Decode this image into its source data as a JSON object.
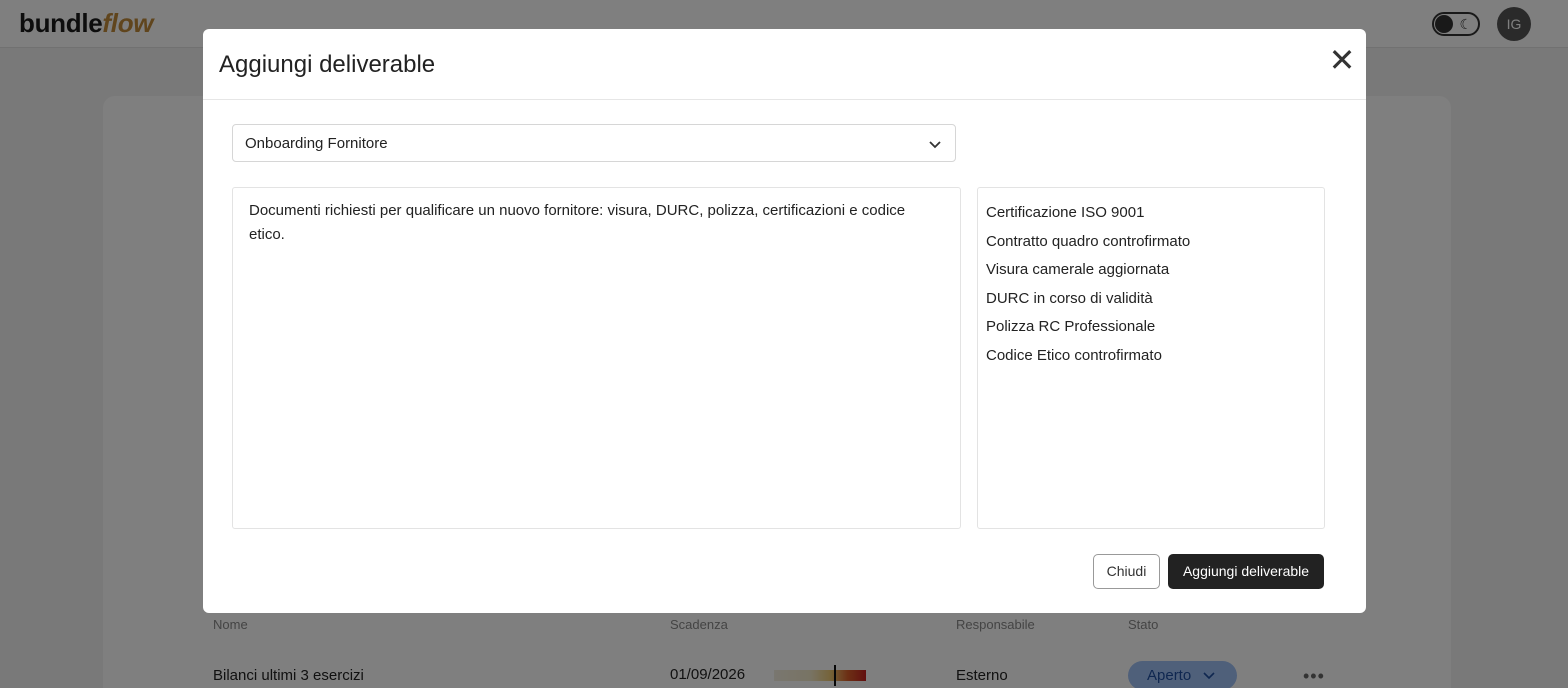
{
  "app": {
    "logo_main": "bundle",
    "logo_accent": "flow",
    "avatar_initials": "IG",
    "theme_toggle_icon": "moon-icon"
  },
  "table": {
    "headers": [
      "Nome",
      "Scadenza",
      "Responsabile",
      "Stato"
    ],
    "rows": [
      {
        "name": "Bilanci ultimi 3 esercizi",
        "due": "01/09/2026",
        "owner": "Esterno",
        "status": "Aperto"
      }
    ],
    "row_menu_icon": "ellipsis-icon",
    "row_menu_glyph": "•••"
  },
  "modal": {
    "title": "Aggiungi deliverable",
    "close_glyph": "✕",
    "template_select": {
      "value": "Onboarding Fornitore"
    },
    "description": "Documenti richiesti per qualificare un nuovo fornitore: visura, DURC, polizza, certificazioni e codice etico.",
    "items": [
      "Certificazione ISO 9001",
      "Contratto quadro controfirmato",
      "Visura camerale aggiornata",
      "DURC in corso di validità",
      "Polizza RC Professionale",
      "Codice Etico controfirmato"
    ],
    "buttons": {
      "close_label": "Chiudi",
      "submit_label": "Aggiungi deliverable"
    }
  },
  "colors": {
    "brand_accent": "#c08a3a",
    "primary_button": "#222222",
    "status_pill_bg": "#9ec0f5",
    "status_pill_text": "#1f4fa0"
  }
}
